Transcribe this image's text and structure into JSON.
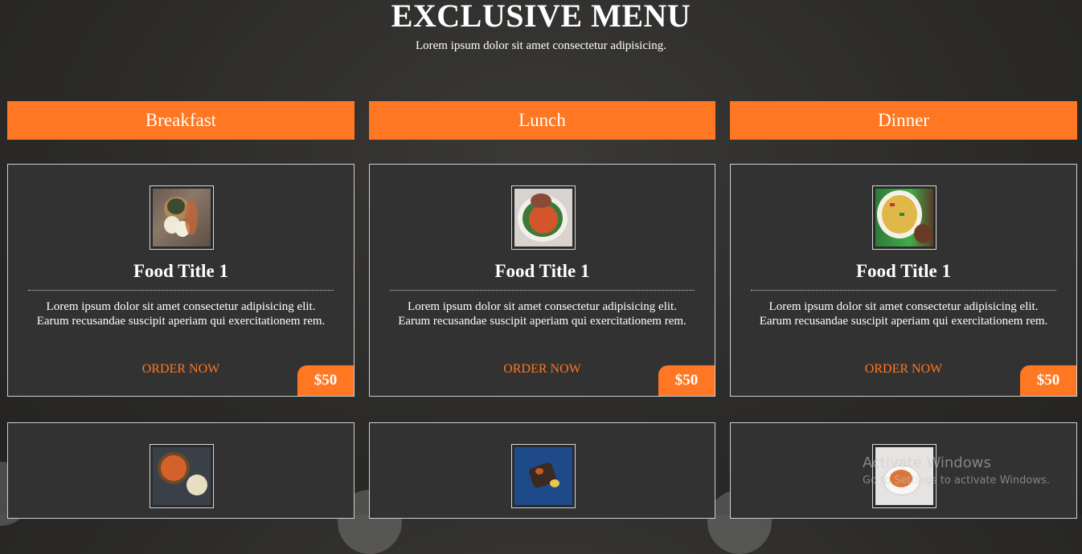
{
  "header": {
    "title": "EXCLUSIVE MENU",
    "subtitle": "Lorem ipsum dolor sit amet consectetur adipisicing."
  },
  "columns": [
    {
      "label": "Breakfast"
    },
    {
      "label": "Lunch"
    },
    {
      "label": "Dinner"
    }
  ],
  "cards": [
    {
      "title": "Food Title 1",
      "desc": "Lorem ipsum dolor sit amet consectetur adipisicing elit. Earum recusandae suscipit aperiam qui exercitationem rem.",
      "order": "ORDER NOW",
      "price": "$50"
    },
    {
      "title": "Food Title 1",
      "desc": "Lorem ipsum dolor sit amet consectetur adipisicing elit. Earum recusandae suscipit aperiam qui exercitationem rem.",
      "order": "ORDER NOW",
      "price": "$50"
    },
    {
      "title": "Food Title 1",
      "desc": "Lorem ipsum dolor sit amet consectetur adipisicing elit. Earum recusandae suscipit aperiam qui exercitationem rem.",
      "order": "ORDER NOW",
      "price": "$50"
    }
  ],
  "watermark": {
    "line1": "Activate Windows",
    "line2": "Go to Settings to activate Windows."
  },
  "colors": {
    "accent": "#ff7722",
    "card_bg": "#323232"
  }
}
